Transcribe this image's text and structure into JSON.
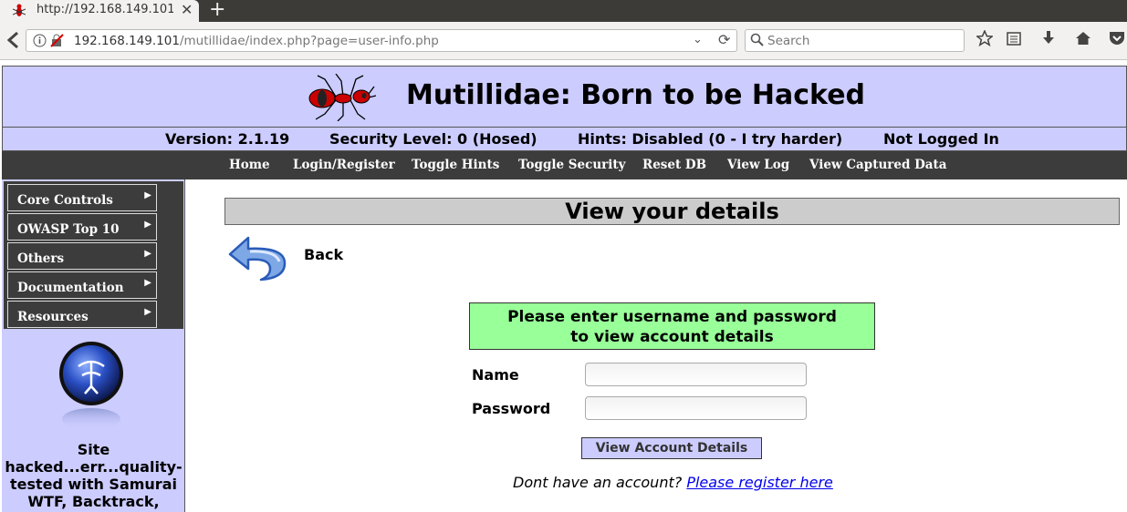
{
  "browser": {
    "tab_title": "http://192.168.149.101",
    "url_host": "192.168.149.101",
    "url_path": "/mutillidae/index.php?page=user-info.php",
    "search_placeholder": "Search"
  },
  "header": {
    "title": "Mutillidae: Born to be Hacked"
  },
  "status": {
    "version": "Version: 2.1.19",
    "security": "Security Level: 0 (Hosed)",
    "hints": "Hints: Disabled (0 - I try harder)",
    "login": "Not Logged In"
  },
  "menu": [
    "Home",
    "Login/Register",
    "Toggle Hints",
    "Toggle Security",
    "Reset DB",
    "View Log",
    "View Captured Data"
  ],
  "sidebar": {
    "items": [
      "Core Controls",
      "OWASP Top 10",
      "Others",
      "Documentation",
      "Resources"
    ],
    "text": "Site hacked...err...quality-tested with Samurai WTF, Backtrack,"
  },
  "main": {
    "title": "View your details",
    "back_label": "Back",
    "prompt_line1": "Please enter username and password",
    "prompt_line2": "to view account details",
    "name_label": "Name",
    "password_label": "Password",
    "name_value": "",
    "password_value": "",
    "submit_label": "View Account Details",
    "register_text": "Dont have an account? ",
    "register_link": "Please register here"
  },
  "colors": {
    "header_bg": "#ccccff",
    "menu_bg": "#3c3c3c",
    "prompt_bg": "#99ff99",
    "title_bar_bg": "#cccccc",
    "link": "#0000ee"
  }
}
